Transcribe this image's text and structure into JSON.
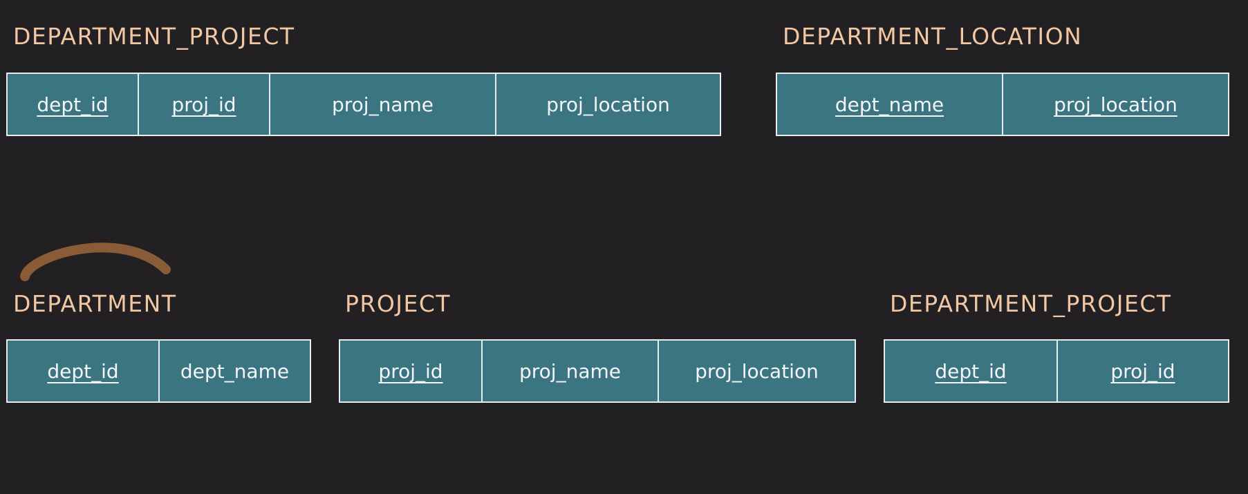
{
  "colors": {
    "background": "#222023",
    "title": "#f1c7a4",
    "cell_fill": "#3b7582",
    "cell_border": "#e8eef0",
    "annotation_stroke": "#8a5b37"
  },
  "tables": {
    "department_project_top": {
      "title": "DEPARTMENT_PROJECT",
      "columns": [
        {
          "name": "dept_id",
          "is_key": true
        },
        {
          "name": "proj_id",
          "is_key": true
        },
        {
          "name": "proj_name",
          "is_key": false
        },
        {
          "name": "proj_location",
          "is_key": false
        }
      ]
    },
    "department_location": {
      "title": "DEPARTMENT_LOCATION",
      "columns": [
        {
          "name": "dept_name",
          "is_key": true
        },
        {
          "name": "proj_location",
          "is_key": true
        }
      ]
    },
    "department": {
      "title": "DEPARTMENT",
      "columns": [
        {
          "name": "dept_id",
          "is_key": true
        },
        {
          "name": "dept_name",
          "is_key": false
        }
      ]
    },
    "project": {
      "title": "PROJECT",
      "columns": [
        {
          "name": "proj_id",
          "is_key": true
        },
        {
          "name": "proj_name",
          "is_key": false
        },
        {
          "name": "proj_location",
          "is_key": false
        }
      ]
    },
    "department_project_bottom": {
      "title": "DEPARTMENT_PROJECT",
      "columns": [
        {
          "name": "dept_id",
          "is_key": true
        },
        {
          "name": "proj_id",
          "is_key": true
        }
      ]
    }
  }
}
